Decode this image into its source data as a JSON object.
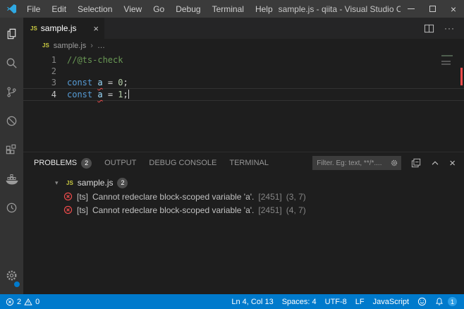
{
  "title_bar": {
    "menus": [
      "File",
      "Edit",
      "Selection",
      "View",
      "Go",
      "Debug",
      "Terminal",
      "Help"
    ],
    "title": "sample.js - qiita - Visual Studio C…"
  },
  "activity_bar": {
    "items": [
      "explorer",
      "search",
      "source-control",
      "debug",
      "extensions",
      "docker",
      "clock-extension"
    ],
    "manage": "settings-gear"
  },
  "tab_bar": {
    "tab_label": "sample.js"
  },
  "breadcrumb": {
    "file": "sample.js",
    "separator": "›",
    "more": "…"
  },
  "editor": {
    "lines": [
      {
        "num": "1",
        "tokens": [
          {
            "text": "//@ts-check",
            "style": "comment"
          }
        ]
      },
      {
        "num": "2",
        "tokens": []
      },
      {
        "num": "3",
        "tokens": [
          {
            "text": "const ",
            "style": "keyword"
          },
          {
            "text": "a",
            "style": "variable-error"
          },
          {
            "text": " = ",
            "style": "plain"
          },
          {
            "text": "0",
            "style": "number"
          },
          {
            "text": ";",
            "style": "plain"
          }
        ]
      },
      {
        "num": "4",
        "tokens": [
          {
            "text": "const ",
            "style": "keyword"
          },
          {
            "text": "a",
            "style": "variable-error"
          },
          {
            "text": " = ",
            "style": "plain"
          },
          {
            "text": "1",
            "style": "number"
          },
          {
            "text": ";",
            "style": "plain"
          }
        ]
      }
    ]
  },
  "panel": {
    "tabs": [
      {
        "label": "PROBLEMS",
        "badge": "2"
      },
      {
        "label": "OUTPUT"
      },
      {
        "label": "DEBUG CONSOLE"
      },
      {
        "label": "TERMINAL"
      }
    ],
    "filter_placeholder": "Filter. Eg: text, **/*....",
    "group": {
      "file": "sample.js",
      "badge": "2"
    },
    "items": [
      {
        "source": "[ts]",
        "message": "Cannot redeclare block-scoped variable 'a'.",
        "code": "[2451]",
        "position": "(3, 7)"
      },
      {
        "source": "[ts]",
        "message": "Cannot redeclare block-scoped variable 'a'.",
        "code": "[2451]",
        "position": "(4, 7)"
      }
    ]
  },
  "status_bar": {
    "errors": "2",
    "warnings": "0",
    "cursor_position": "Ln 4, Col 13",
    "indentation": "Spaces: 4",
    "encoding": "UTF-8",
    "eol": "LF",
    "language": "JavaScript",
    "notification_count": "1"
  },
  "icons": {
    "js": "JS",
    "close": "×",
    "more": "···",
    "chevron_down": "▾"
  },
  "colors": {
    "accent": "#007acc",
    "error": "#f14c4c",
    "comment": "#6a9955",
    "keyword": "#569cd6",
    "variable": "#9cdcfe",
    "number": "#b5cea8",
    "titlebar": "#3b3b3b",
    "activitybar": "#333333",
    "editor_bg": "#1e1e1e",
    "tabbar_bg": "#252526"
  }
}
